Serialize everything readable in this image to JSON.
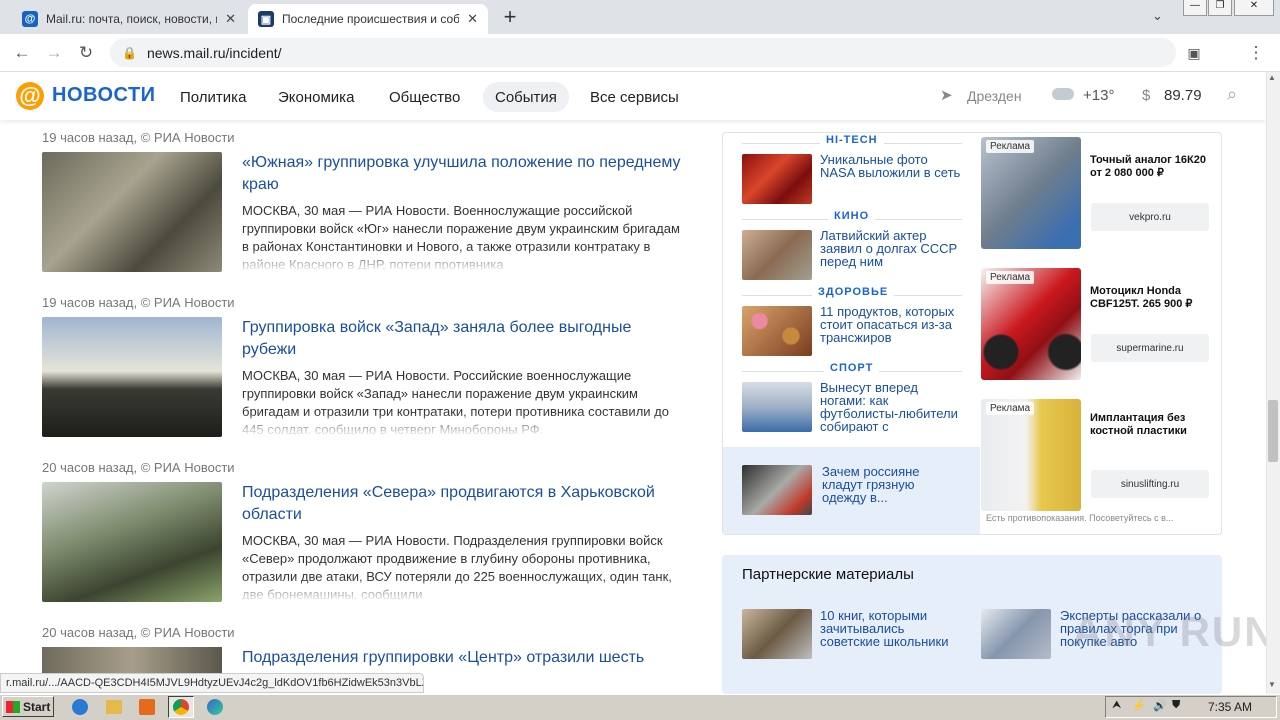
{
  "browser": {
    "tabs": [
      {
        "title": "Mail.ru: почта, поиск, новости, пр",
        "active": false,
        "favicon": "mail-at-icon"
      },
      {
        "title": "Последние происшествия и событ",
        "active": true,
        "favicon": "news-icon"
      }
    ],
    "new_tab_label": "+",
    "url": "news.mail.ru/incident/"
  },
  "site": {
    "logo_text": "НОВОСТИ",
    "nav": [
      "Политика",
      "Экономика",
      "Общество",
      "События",
      "Все сервисы"
    ],
    "active_nav": "События",
    "location": "Дрезден",
    "weather": "+13°",
    "currency_symbol": "$",
    "rate": "89.79"
  },
  "feed": [
    {
      "meta": "19 часов назад, © РИА Новости",
      "title": "«Южная» группировка улучшила положение по переднему краю",
      "text": "МОСКВА, 30 мая — РИА Новости. Военнослужащие российской группировки войск «Юг» нанесли поражение двум украинским бригадам в районах Константиновки и Нового, а также отразили контратаку в районе Красного в ДНР, потери противника"
    },
    {
      "meta": "19 часов назад, © РИА Новости",
      "title": "Группировка войск «Запад» заняла более выгодные рубежи",
      "text": "МОСКВА, 30 мая — РИА Новости. Российские военнослужащие группировки войск «Запад» нанесли поражение двум украинским бригадам и отразили три контратаки, потери противника составили до 445 солдат, сообщило в четверг Минобороны РФ."
    },
    {
      "meta": "20 часов назад, © РИА Новости",
      "title": "Подразделения «Севера» продвигаются в Харьковской области",
      "text": "МОСКВА, 30 мая — РИА Новости. Подразделения группировки войск «Север» продолжают продвижение в глубину обороны противника, отразили две атаки, ВСУ потеряли до 225 военнослужащих, один танк, две бронемашины, сообщили"
    },
    {
      "meta": "20 часов назад, © РИА Новости",
      "title": "Подразделения группировки «Центр» отразили шесть",
      "text": ""
    }
  ],
  "sidebar": [
    {
      "section": "HI-TECH",
      "title": "Уникальные фото NASA выложили в сеть"
    },
    {
      "section": "КИНО",
      "title": "Латвийский актер заявил о долгах СССР перед ним"
    },
    {
      "section": "ЗДОРОВЬЕ",
      "title": "11 продуктов, которых стоит опасаться из-за трансжиров"
    },
    {
      "section": "СПОРТ",
      "title": "Вынесут вперед ногами: как футболисты-любители собирают с"
    }
  ],
  "sidebar_promo": {
    "title": "Зачем россияне кладут грязную одежду в..."
  },
  "ads": [
    {
      "label": "Реклама",
      "title": "Точный аналог 16К20 от 2 080 000 ₽",
      "domain": "vekpro.ru"
    },
    {
      "label": "Реклама",
      "title": "Мотоцикл Honda CBF125T. 265 900 ₽",
      "domain": "supermarine.ru"
    },
    {
      "label": "Реклама",
      "title": "Имплантация без костной пластики",
      "domain": "sinuslifting.ru"
    }
  ],
  "ad_disclaimer": "Есть противопоказания. Посоветуйтесь с в...",
  "partners": {
    "heading": "Партнерские материалы",
    "items": [
      {
        "title": "10 книг, которыми зачитывались советские школьники"
      },
      {
        "title": "Эксперты рассказали о правилах торга при покупке авто"
      }
    ]
  },
  "status_url": "r.mail.ru/.../AACD-QE3CDH4I5MJVL9HdtyzUEvJ4c2g_ldKdOV1fb6HZidwEk53n3VbLZ...",
  "taskbar": {
    "start_label": "Start",
    "clock": "7:35 AM"
  },
  "watermark": "ANY RUN"
}
